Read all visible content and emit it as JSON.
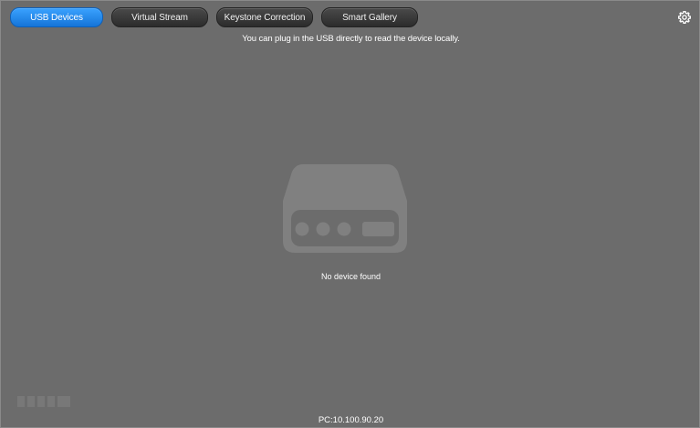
{
  "tabs": [
    {
      "label": "USB Devices",
      "active": true
    },
    {
      "label": "Virtual Stream",
      "active": false
    },
    {
      "label": "Keystone Correction",
      "active": false
    },
    {
      "label": "Smart Gallery",
      "active": false
    }
  ],
  "hint": "You can plug in the USB directly to read the device locally.",
  "empty_state": {
    "message": "No device found",
    "icon": "usb-drive-icon"
  },
  "footer": {
    "pc_address": "PC:10.100.90.20"
  },
  "icons": {
    "settings": "gear-icon"
  },
  "colors": {
    "background": "#6c6c6c",
    "active_tab": "#2b8eef",
    "inactive_tab": "#3a3a3a",
    "illustration": "#808080",
    "text": "#ffffff"
  }
}
